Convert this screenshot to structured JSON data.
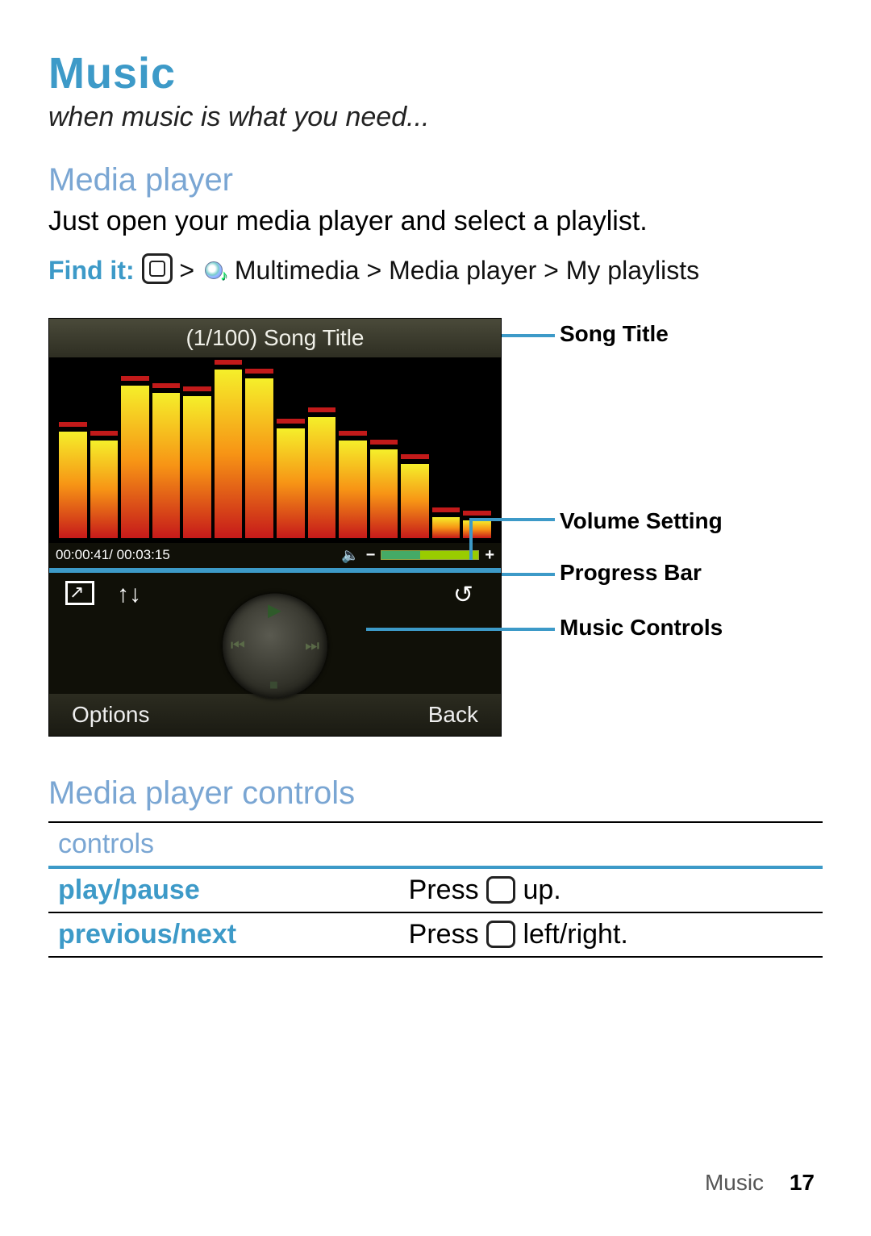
{
  "title": "Music",
  "tagline": "when music is what you need...",
  "sections": {
    "media_player_h": "Media player",
    "media_player_body": "Just open your media player and select a playlist.",
    "find_it_label": "Find it:",
    "find_it_path": "Multimedia > Media player > My playlists",
    "controls_h": "Media player controls"
  },
  "player": {
    "song_title": "(1/100) Song Title",
    "elapsed": "00:00:41/ 00:03:15",
    "softkeys": {
      "left": "Options",
      "right": "Back"
    },
    "viz_bars": [
      60,
      55,
      86,
      82,
      80,
      95,
      90,
      62,
      68,
      55,
      50,
      42,
      12,
      10
    ]
  },
  "annotations": {
    "song_title": "Song Title",
    "volume": "Volume Setting",
    "progress": "Progress Bar",
    "controls": "Music Controls"
  },
  "table": {
    "header": "controls",
    "rows": [
      {
        "cmd": "play/pause",
        "action_pre": "Press ",
        "action_post": " up."
      },
      {
        "cmd": "previous/next",
        "action_pre": "Press ",
        "action_post": " left/right."
      }
    ]
  },
  "footer": {
    "section": "Music",
    "page": "17"
  }
}
